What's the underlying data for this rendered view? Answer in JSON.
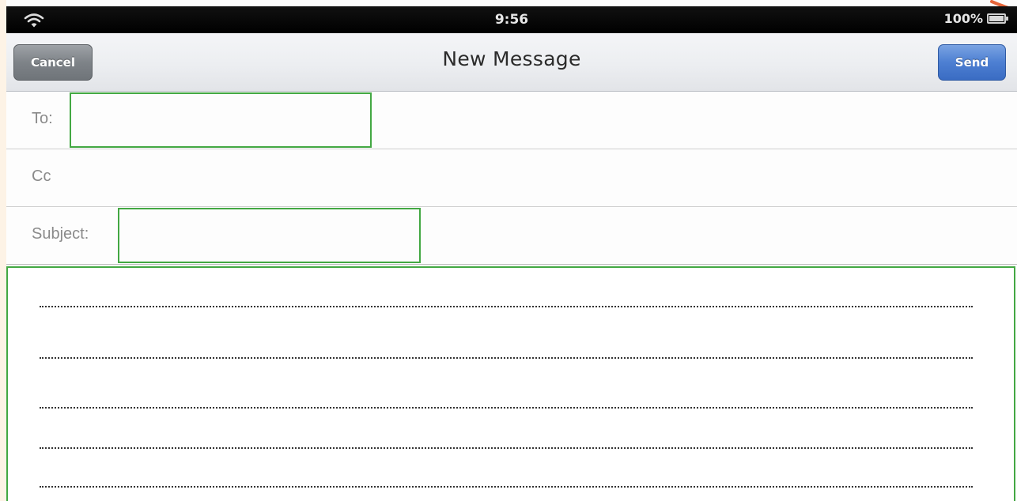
{
  "status_bar": {
    "time": "9:56",
    "battery": "100%",
    "wifi_icon": "wifi-icon",
    "battery_icon": "battery-icon"
  },
  "nav_bar": {
    "title": "New Message",
    "cancel_label": "Cancel",
    "send_label": "Send"
  },
  "fields": {
    "to_label": "To:",
    "cc_label": "Cc",
    "subject_label": "Subject:"
  },
  "colors": {
    "answer_box_border": "#43a843",
    "send_button": "#4d7fd2",
    "cancel_button": "#7e8388"
  }
}
